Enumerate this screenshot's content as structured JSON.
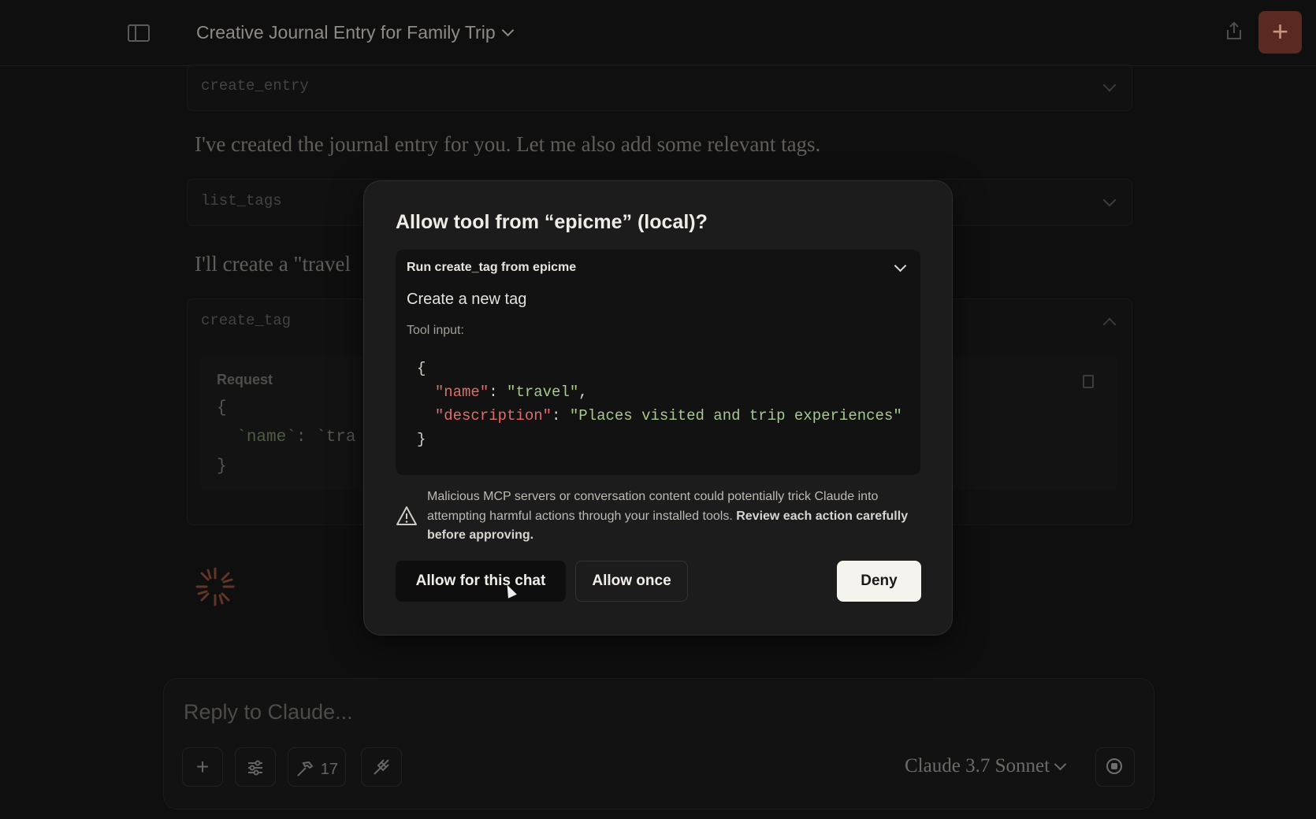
{
  "header": {
    "chat_title": "Creative Journal Entry for Family Trip"
  },
  "conversation": {
    "tool_create_entry": "create_entry",
    "message_1": "I've created the journal entry for you. Let me also add some relevant tags.",
    "tool_list_tags": "list_tags",
    "message_2": "I'll create a \"travel",
    "tool_create_tag": "create_tag",
    "request_label": "Request",
    "request_open": "{",
    "request_key": "`name`",
    "request_colon": ":",
    "request_value": "`tra",
    "request_close": "}"
  },
  "composer": {
    "placeholder": "Reply to Claude...",
    "tools_count": "17",
    "model": "Claude 3.7 Sonnet"
  },
  "dialog": {
    "title": "Allow tool from “epicme” (local)?",
    "run_label": "Run create_tag from epicme",
    "tool_description": "Create a new tag",
    "tool_input_label": "Tool input:",
    "code": {
      "open": "{",
      "key_name": "\"name\"",
      "val_name": "\"travel\"",
      "key_desc": "\"description\"",
      "val_desc": "\"Places visited and trip experiences\"",
      "close": "}"
    },
    "warning_text": "Malicious MCP servers or conversation content could potentially trick Claude into attempting harmful actions through your installed tools. ",
    "warning_bold": "Review each action carefully before approving.",
    "btn_allow_chat": "Allow for this chat",
    "btn_allow_once": "Allow once",
    "btn_deny": "Deny"
  },
  "colors": {
    "accent_new_chat": "#5a2a22",
    "json_key": "#e06c6c",
    "json_string": "#a6c98d",
    "deny_button_bg": "#f5f3ee"
  },
  "icons": [
    "sidebar-toggle-icon",
    "chevron-down-icon",
    "share-icon",
    "plus-icon",
    "clipboard-icon",
    "spinner-icon",
    "sliders-icon",
    "hammer-icon",
    "plug-icon",
    "stop-icon",
    "warning-icon"
  ]
}
